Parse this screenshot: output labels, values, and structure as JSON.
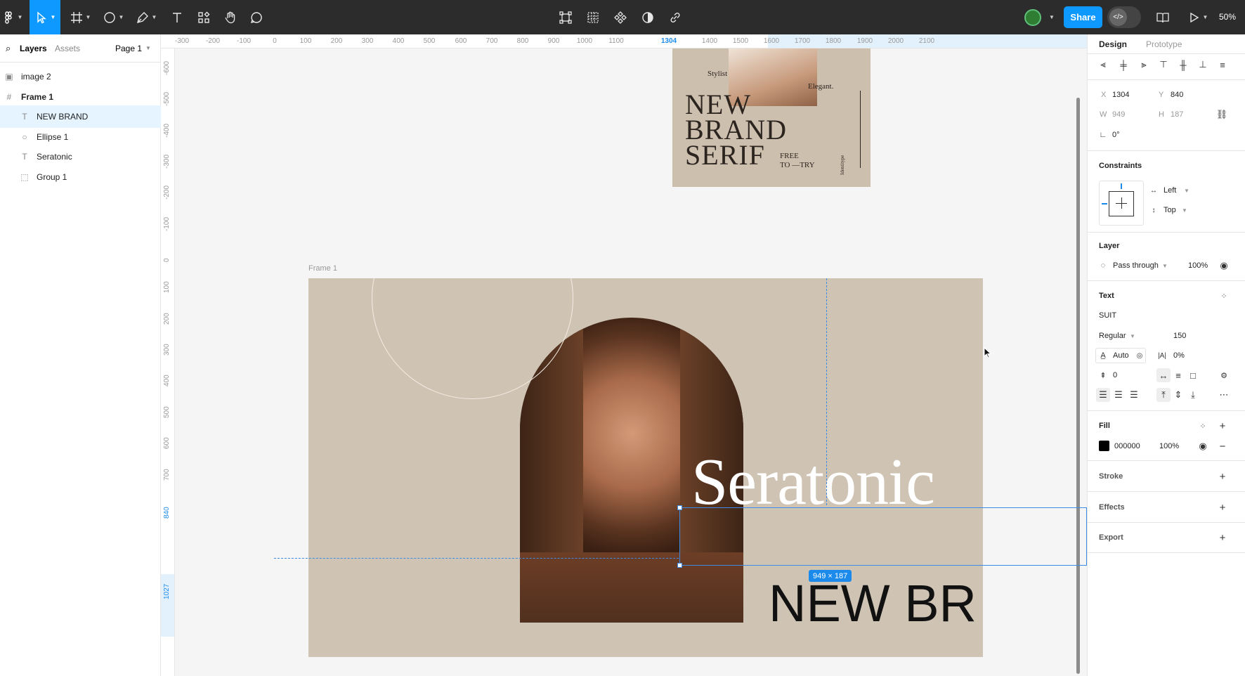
{
  "colors": {
    "accent": "#0d99ff",
    "toolbar_bg": "#2c2c2c",
    "frame_bg": "#cfc3b4",
    "fill": "#000000"
  },
  "toolbar": {
    "share_label": "Share",
    "zoom": "50%",
    "tools": [
      "move-tool",
      "frame-tool",
      "shape-tool",
      "pen-tool",
      "text-tool",
      "resources-tool",
      "hand-tool",
      "comment-tool"
    ],
    "center_tools": [
      "transform-icon",
      "grid-icon",
      "component-icon",
      "contrast-icon",
      "link-icon"
    ]
  },
  "left_panel": {
    "tabs": {
      "layers": "Layers",
      "assets": "Assets",
      "page": "Page 1"
    },
    "layers": [
      {
        "name": "image 2",
        "icon": "image-icon",
        "level": 0
      },
      {
        "name": "Frame 1",
        "icon": "frame-icon",
        "level": 0
      },
      {
        "name": "NEW BRAND",
        "icon": "text-icon",
        "level": 1,
        "selected": true
      },
      {
        "name": "Ellipse 1",
        "icon": "ellipse-icon",
        "level": 1
      },
      {
        "name": "Seratonic",
        "icon": "text-icon",
        "level": 1
      },
      {
        "name": "Group 1",
        "icon": "group-icon",
        "level": 1
      }
    ]
  },
  "rulers": {
    "top": [
      "-300",
      "-200",
      "-100",
      "0",
      "100",
      "200",
      "300",
      "400",
      "500",
      "600",
      "700",
      "800",
      "900",
      "1000",
      "1100",
      "1304",
      "1400",
      "1500",
      "1600",
      "1700",
      "1800",
      "1900",
      "2000",
      "2100"
    ],
    "left": [
      "-600",
      "-500",
      "-400",
      "-300",
      "-200",
      "-100",
      "0",
      "100",
      "200",
      "300",
      "400",
      "500",
      "600",
      "700",
      "840",
      "1027"
    ]
  },
  "canvas": {
    "frame_label": "Frame 1",
    "poster": {
      "headline": "NEW BRAND SERIF",
      "line1": "NEW",
      "line2": "BRAND",
      "line3": "SERIF",
      "stylist": "Stylist",
      "elegant": "Elegant.",
      "free": "FREE",
      "totry": "TO —TRY",
      "side": "Identitype"
    },
    "seratonic_text": "Seratonic",
    "newbrand_text": "NEW BR",
    "selection_size": "949 × 187"
  },
  "right_panel": {
    "tabs": {
      "design": "Design",
      "prototype": "Prototype"
    },
    "position": {
      "x_label": "X",
      "x": "1304",
      "y_label": "Y",
      "y": "840",
      "w_label": "W",
      "w": "949",
      "h_label": "H",
      "h": "187",
      "rotation": "0°"
    },
    "constraints": {
      "title": "Constraints",
      "horizontal": "Left",
      "vertical": "Top"
    },
    "layer": {
      "title": "Layer",
      "blend": "Pass through",
      "opacity": "100%"
    },
    "text": {
      "title": "Text",
      "font": "SUIT",
      "weight": "Regular",
      "size": "150",
      "line_height": "Auto",
      "letter_spacing": "0%",
      "paragraph_spacing": "0"
    },
    "fill": {
      "title": "Fill",
      "hex": "000000",
      "opacity": "100%"
    },
    "stroke": {
      "title": "Stroke"
    },
    "effects": {
      "title": "Effects"
    },
    "export": {
      "title": "Export"
    }
  }
}
